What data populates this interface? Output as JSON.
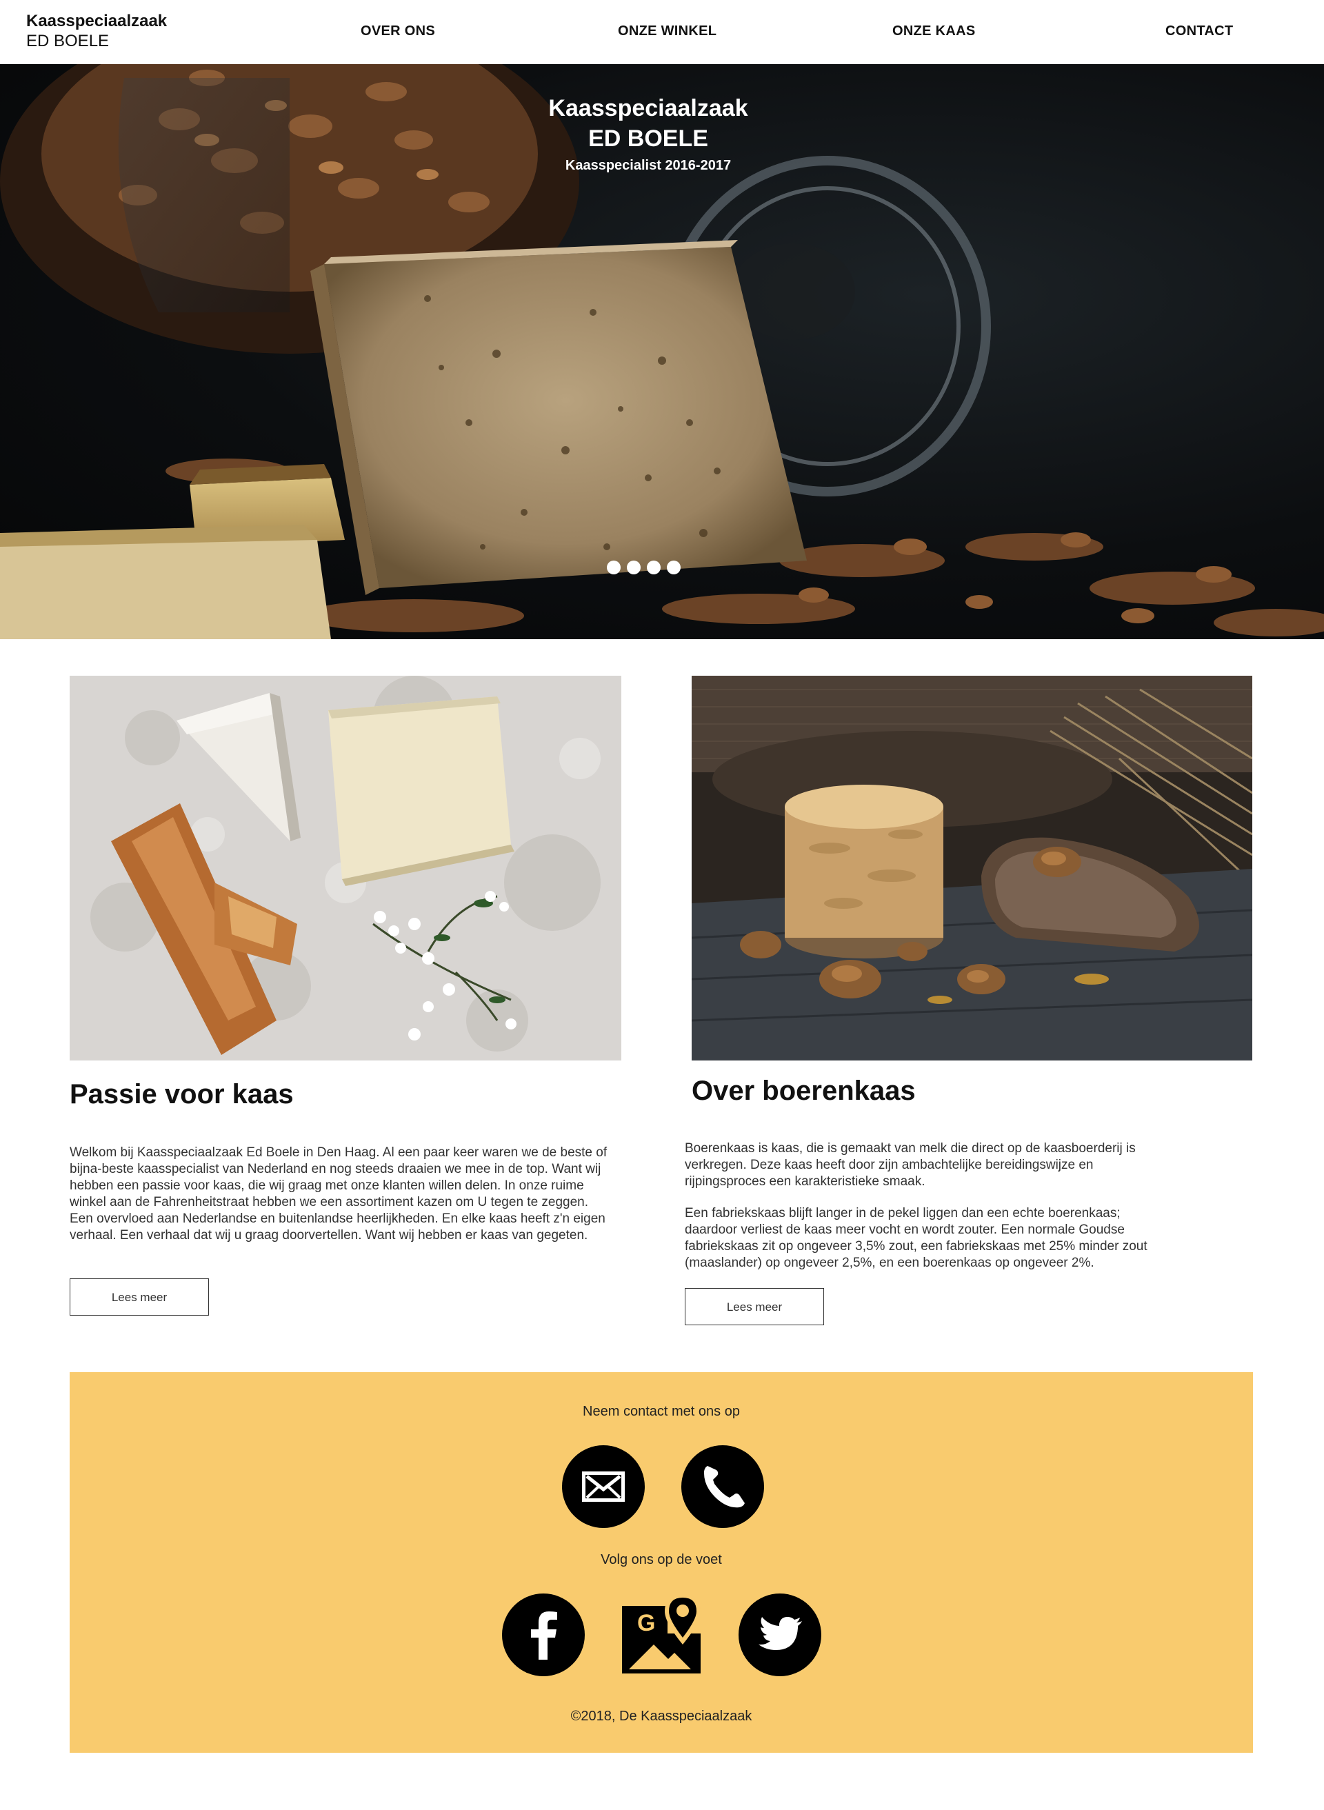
{
  "header": {
    "brand_name": "Kaasspeciaalzaak",
    "brand_sub": "ED BOELE",
    "nav": [
      "OVER ONS",
      "ONZE WINKEL",
      "ONZE KAAS",
      "CONTACT"
    ]
  },
  "hero": {
    "title_line1": "Kaasspeciaalzaak",
    "title_line2": "ED BOELE",
    "subtitle": "Kaasspecialist 2016-2017",
    "slide_count": 4
  },
  "articles": [
    {
      "title": "Passie voor kaas",
      "body": "Welkom bij Kaasspeciaalzaak Ed Boele in Den Haag. Al een paar keer waren we de beste of bijna-beste kaasspecialist van Nederland en nog steeds draaien we mee in de top. Want wij hebben een passie voor kaas, die wij graag met onze klanten willen delen. In onze ruime winkel aan de Fahrenheitstraat hebben we een assortiment kazen om U tegen te zeggen. Een overvloed aan Nederlandse en buitenlandse heerlijkheden. En elke kaas heeft z'n eigen verhaal. Een verhaal dat wij u graag doorvertellen. Want wij hebben er kaas van gegeten.",
      "button": "Lees meer"
    },
    {
      "title": "Over boerenkaas",
      "body1": "Boerenkaas is kaas, die is gemaakt van melk die direct op de kaasboerderij is verkregen. Deze kaas heeft door zijn ambachtelijke bereidingswijze en rijpingsproces een karakteristieke smaak.",
      "body2": "Een fabriekskaas blijft langer in de pekel liggen dan een echte boerenkaas; daardoor verliest de kaas meer vocht en wordt zouter. Een normale Goudse fabriekskaas zit op ongeveer 3,5% zout, een fabriekskaas met 25% minder zout (maaslander) op ongeveer 2,5%, en een boerenkaas op ongeveer 2%.",
      "button": "Lees meer"
    }
  ],
  "footer": {
    "contact_heading": "Neem contact met ons op",
    "follow_heading": "Volg ons op de voet",
    "copyright": "©2018, De Kaasspeciaalzaak",
    "contact_icons": [
      "envelope-icon",
      "phone-icon"
    ],
    "social_icons": [
      "facebook-icon",
      "google-maps-icon",
      "twitter-icon"
    ]
  },
  "colors": {
    "footer_bg": "#f9cb6e",
    "icon_fill": "#000000",
    "text": "#111111"
  }
}
